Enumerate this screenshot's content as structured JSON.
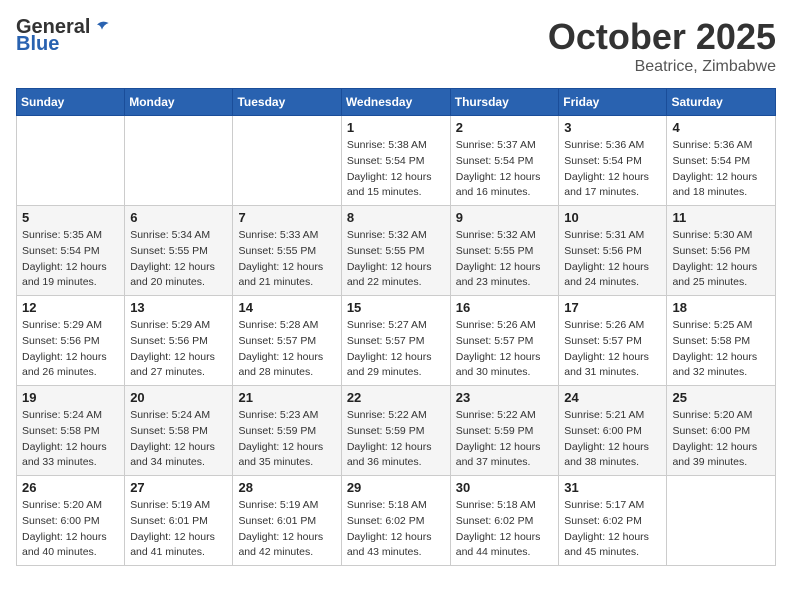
{
  "header": {
    "logo_general": "General",
    "logo_blue": "Blue",
    "month": "October 2025",
    "location": "Beatrice, Zimbabwe"
  },
  "weekdays": [
    "Sunday",
    "Monday",
    "Tuesday",
    "Wednesday",
    "Thursday",
    "Friday",
    "Saturday"
  ],
  "weeks": [
    [
      {
        "day": "",
        "info": ""
      },
      {
        "day": "",
        "info": ""
      },
      {
        "day": "",
        "info": ""
      },
      {
        "day": "1",
        "info": "Sunrise: 5:38 AM\nSunset: 5:54 PM\nDaylight: 12 hours\nand 15 minutes."
      },
      {
        "day": "2",
        "info": "Sunrise: 5:37 AM\nSunset: 5:54 PM\nDaylight: 12 hours\nand 16 minutes."
      },
      {
        "day": "3",
        "info": "Sunrise: 5:36 AM\nSunset: 5:54 PM\nDaylight: 12 hours\nand 17 minutes."
      },
      {
        "day": "4",
        "info": "Sunrise: 5:36 AM\nSunset: 5:54 PM\nDaylight: 12 hours\nand 18 minutes."
      }
    ],
    [
      {
        "day": "5",
        "info": "Sunrise: 5:35 AM\nSunset: 5:54 PM\nDaylight: 12 hours\nand 19 minutes."
      },
      {
        "day": "6",
        "info": "Sunrise: 5:34 AM\nSunset: 5:55 PM\nDaylight: 12 hours\nand 20 minutes."
      },
      {
        "day": "7",
        "info": "Sunrise: 5:33 AM\nSunset: 5:55 PM\nDaylight: 12 hours\nand 21 minutes."
      },
      {
        "day": "8",
        "info": "Sunrise: 5:32 AM\nSunset: 5:55 PM\nDaylight: 12 hours\nand 22 minutes."
      },
      {
        "day": "9",
        "info": "Sunrise: 5:32 AM\nSunset: 5:55 PM\nDaylight: 12 hours\nand 23 minutes."
      },
      {
        "day": "10",
        "info": "Sunrise: 5:31 AM\nSunset: 5:56 PM\nDaylight: 12 hours\nand 24 minutes."
      },
      {
        "day": "11",
        "info": "Sunrise: 5:30 AM\nSunset: 5:56 PM\nDaylight: 12 hours\nand 25 minutes."
      }
    ],
    [
      {
        "day": "12",
        "info": "Sunrise: 5:29 AM\nSunset: 5:56 PM\nDaylight: 12 hours\nand 26 minutes."
      },
      {
        "day": "13",
        "info": "Sunrise: 5:29 AM\nSunset: 5:56 PM\nDaylight: 12 hours\nand 27 minutes."
      },
      {
        "day": "14",
        "info": "Sunrise: 5:28 AM\nSunset: 5:57 PM\nDaylight: 12 hours\nand 28 minutes."
      },
      {
        "day": "15",
        "info": "Sunrise: 5:27 AM\nSunset: 5:57 PM\nDaylight: 12 hours\nand 29 minutes."
      },
      {
        "day": "16",
        "info": "Sunrise: 5:26 AM\nSunset: 5:57 PM\nDaylight: 12 hours\nand 30 minutes."
      },
      {
        "day": "17",
        "info": "Sunrise: 5:26 AM\nSunset: 5:57 PM\nDaylight: 12 hours\nand 31 minutes."
      },
      {
        "day": "18",
        "info": "Sunrise: 5:25 AM\nSunset: 5:58 PM\nDaylight: 12 hours\nand 32 minutes."
      }
    ],
    [
      {
        "day": "19",
        "info": "Sunrise: 5:24 AM\nSunset: 5:58 PM\nDaylight: 12 hours\nand 33 minutes."
      },
      {
        "day": "20",
        "info": "Sunrise: 5:24 AM\nSunset: 5:58 PM\nDaylight: 12 hours\nand 34 minutes."
      },
      {
        "day": "21",
        "info": "Sunrise: 5:23 AM\nSunset: 5:59 PM\nDaylight: 12 hours\nand 35 minutes."
      },
      {
        "day": "22",
        "info": "Sunrise: 5:22 AM\nSunset: 5:59 PM\nDaylight: 12 hours\nand 36 minutes."
      },
      {
        "day": "23",
        "info": "Sunrise: 5:22 AM\nSunset: 5:59 PM\nDaylight: 12 hours\nand 37 minutes."
      },
      {
        "day": "24",
        "info": "Sunrise: 5:21 AM\nSunset: 6:00 PM\nDaylight: 12 hours\nand 38 minutes."
      },
      {
        "day": "25",
        "info": "Sunrise: 5:20 AM\nSunset: 6:00 PM\nDaylight: 12 hours\nand 39 minutes."
      }
    ],
    [
      {
        "day": "26",
        "info": "Sunrise: 5:20 AM\nSunset: 6:00 PM\nDaylight: 12 hours\nand 40 minutes."
      },
      {
        "day": "27",
        "info": "Sunrise: 5:19 AM\nSunset: 6:01 PM\nDaylight: 12 hours\nand 41 minutes."
      },
      {
        "day": "28",
        "info": "Sunrise: 5:19 AM\nSunset: 6:01 PM\nDaylight: 12 hours\nand 42 minutes."
      },
      {
        "day": "29",
        "info": "Sunrise: 5:18 AM\nSunset: 6:02 PM\nDaylight: 12 hours\nand 43 minutes."
      },
      {
        "day": "30",
        "info": "Sunrise: 5:18 AM\nSunset: 6:02 PM\nDaylight: 12 hours\nand 44 minutes."
      },
      {
        "day": "31",
        "info": "Sunrise: 5:17 AM\nSunset: 6:02 PM\nDaylight: 12 hours\nand 45 minutes."
      },
      {
        "day": "",
        "info": ""
      }
    ]
  ]
}
